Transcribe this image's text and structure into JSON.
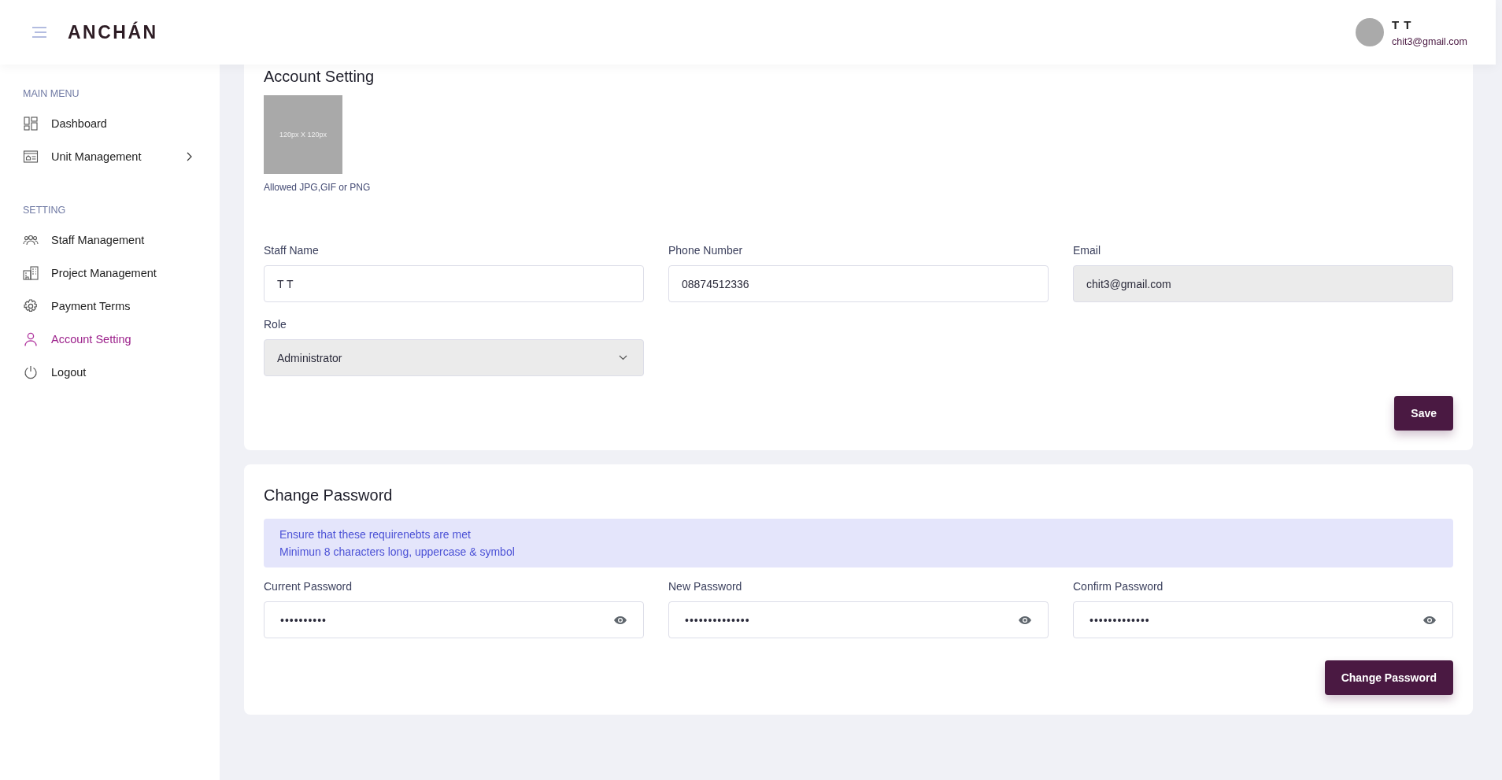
{
  "header": {
    "logo": "ANCHÁN",
    "user": {
      "name": "T T",
      "email": "chit3@gmail.com"
    }
  },
  "sidebar": {
    "sections": [
      {
        "title": "MAIN MENU",
        "items": [
          {
            "label": "Dashboard",
            "selected": false,
            "expandable": false
          },
          {
            "label": "Unit Management",
            "selected": false,
            "expandable": true
          }
        ]
      },
      {
        "title": "SETTING",
        "items": [
          {
            "label": "Staff Management",
            "selected": false,
            "expandable": false
          },
          {
            "label": "Project Management",
            "selected": false,
            "expandable": false
          },
          {
            "label": "Payment Terms",
            "selected": false,
            "expandable": false
          },
          {
            "label": "Account Setting",
            "selected": true,
            "expandable": false
          },
          {
            "label": "Logout",
            "selected": false,
            "expandable": false
          }
        ]
      }
    ]
  },
  "account": {
    "title": "Account Setting",
    "photo": {
      "text": "120px X 120px",
      "hint": "Allowed JPG,GIF or PNG"
    },
    "fields": [
      {
        "label": "Staff Name",
        "value": "T T",
        "kind": "text",
        "disabled": false
      },
      {
        "label": "Phone Number",
        "value": "08874512336",
        "kind": "text",
        "disabled": false
      },
      {
        "label": "Email",
        "value": "chit3@gmail.com",
        "kind": "text",
        "disabled": true
      },
      {
        "label": "Role",
        "value": "Administrator",
        "kind": "select",
        "disabled": true
      }
    ],
    "button": "Save"
  },
  "password": {
    "title": "Change Password",
    "notice": [
      "Ensure that these requirenebts are met",
      "Minimun 8 characters long, uppercase & symbol"
    ],
    "fields": [
      {
        "label": "Current Password",
        "value": "••••••••••"
      },
      {
        "label": "New Password",
        "value": "••••••••••••••"
      },
      {
        "label": "Confirm Password",
        "value": "•••••••••••••"
      }
    ],
    "button": "Change Password"
  }
}
